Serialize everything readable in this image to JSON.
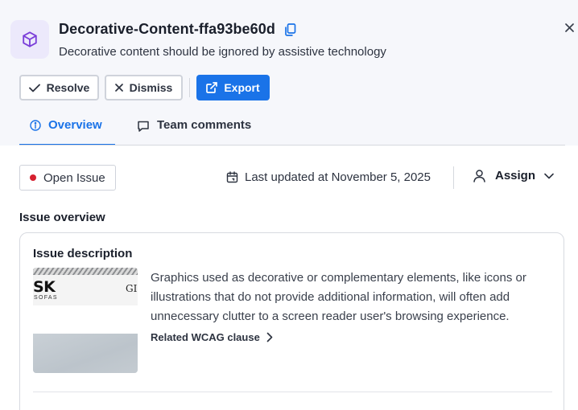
{
  "issue": {
    "title": "Decorative-Content-ffa93be60d",
    "subtitle": "Decorative content should be ignored by assistive technology",
    "icon": "cube-icon"
  },
  "actions": {
    "resolve_label": "Resolve",
    "dismiss_label": "Dismiss",
    "export_label": "Export"
  },
  "tabs": [
    {
      "label": "Overview",
      "icon": "info-icon",
      "active": true
    },
    {
      "label": "Team comments",
      "icon": "comment-icon",
      "active": false
    }
  ],
  "status": {
    "label": "Open Issue",
    "color": "#d6202f"
  },
  "updated": {
    "text": "Last updated at November 5, 2025"
  },
  "assign": {
    "label": "Assign"
  },
  "overview": {
    "section_title": "Issue overview",
    "card_title": "Issue description",
    "description": "Graphics used as decorative or complementary elements, like icons or illustrations that do not provide additional information, will often add unnecessary clutter to a screen reader user's browsing experience.",
    "link_label": "Related WCAG clause",
    "thumbnail": {
      "brand": "SK",
      "tagline": "SOFAS",
      "side_text": "GI"
    }
  },
  "colors": {
    "accent": "#1a73e8",
    "icon_purple": "#7b3fd9",
    "header_bg": "#f6f7fb"
  }
}
